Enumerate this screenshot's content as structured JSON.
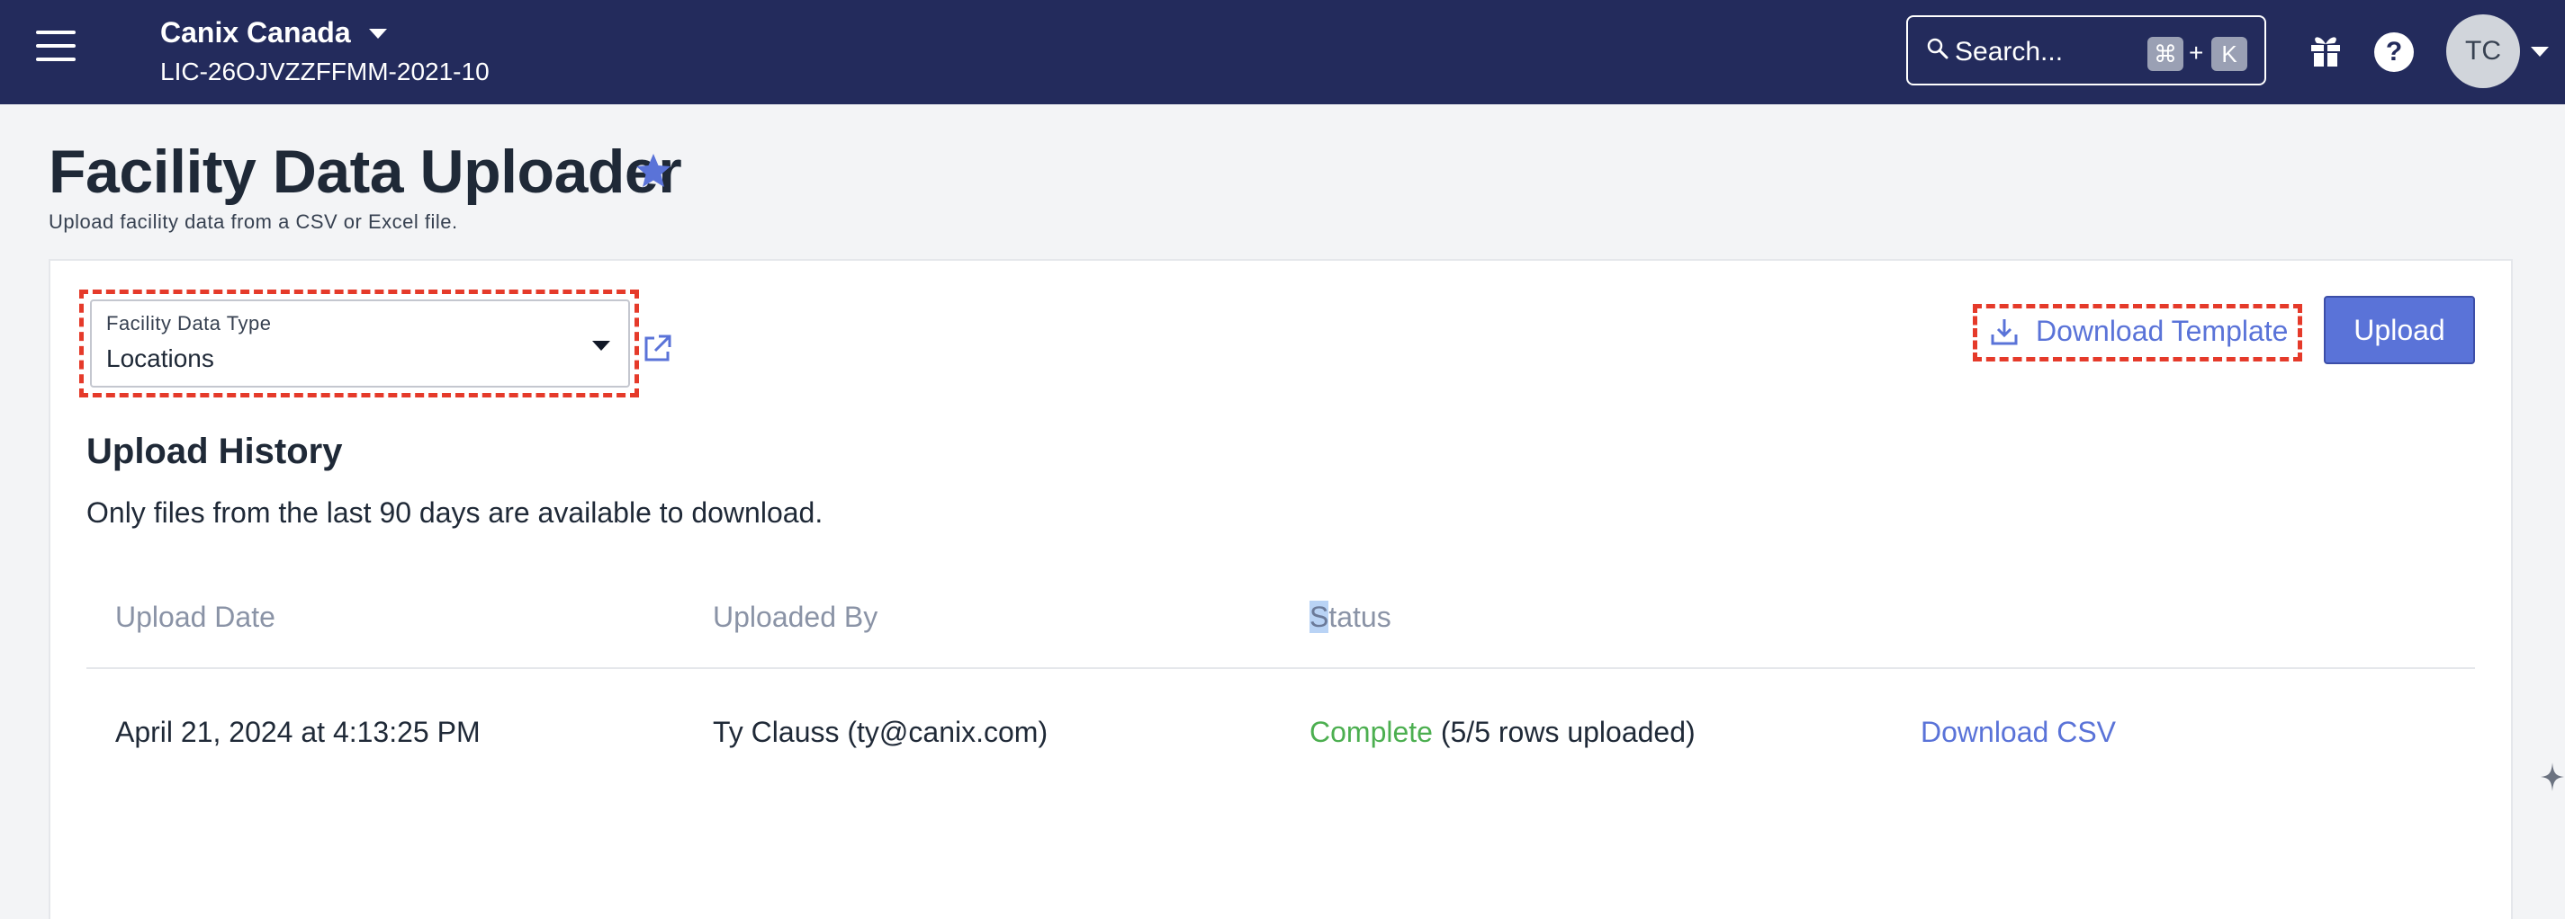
{
  "header": {
    "org_name": "Canix Canada",
    "license": "LIC-26OJVZZFFMM-2021-10",
    "search": {
      "placeholder": "Search...",
      "shortcut_cmd": "⌘",
      "shortcut_plus": "+",
      "shortcut_key": "K"
    },
    "help_glyph": "?",
    "avatar_initials": "TC"
  },
  "page": {
    "title": "Facility Data Uploader",
    "subtitle": "Upload facility data from a CSV or Excel file."
  },
  "controls": {
    "facility_type": {
      "label": "Facility Data Type",
      "value": "Locations"
    },
    "download_template_label": "Download Template",
    "upload_label": "Upload"
  },
  "history": {
    "title": "Upload History",
    "note": "Only files from the last 90 days are available to download.",
    "columns": {
      "date": "Upload Date",
      "by": "Uploaded By",
      "status_first": "S",
      "status_rest": "tatus"
    },
    "rows": [
      {
        "date": "April 21, 2024 at 4:13:25 PM",
        "by": "Ty Clauss (ty@canix.com)",
        "status": "Complete",
        "status_detail": "(5/5 rows uploaded)",
        "action": "Download CSV"
      }
    ]
  },
  "colors": {
    "topbar": "#232b5c",
    "accent": "#5a73d8",
    "success": "#4caf50",
    "highlight": "#e53a2a"
  },
  "icons": [
    "hamburger-icon",
    "chevron-down-icon",
    "search-icon",
    "gift-icon",
    "help-icon",
    "star-icon",
    "external-link-icon",
    "download-icon",
    "sparkle-icon"
  ]
}
